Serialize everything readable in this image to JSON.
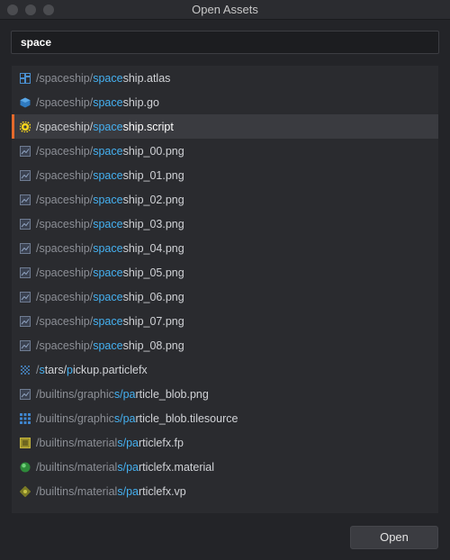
{
  "window": {
    "title": "Open Assets"
  },
  "search": {
    "value": "space"
  },
  "results": [
    {
      "dir": "/spaceship/",
      "match": "space",
      "rest": "ship.atlas",
      "icon": "atlas-icon",
      "selected": false
    },
    {
      "dir": "/spaceship/",
      "match": "space",
      "rest": "ship.go",
      "icon": "gameobject-icon",
      "selected": false
    },
    {
      "dir": "/spaceship/",
      "match": "space",
      "rest": "ship.script",
      "icon": "script-gear-icon",
      "selected": true
    },
    {
      "dir": "/spaceship/",
      "match": "space",
      "rest": "ship_00.png",
      "icon": "image-icon",
      "selected": false
    },
    {
      "dir": "/spaceship/",
      "match": "space",
      "rest": "ship_01.png",
      "icon": "image-icon",
      "selected": false
    },
    {
      "dir": "/spaceship/",
      "match": "space",
      "rest": "ship_02.png",
      "icon": "image-icon",
      "selected": false
    },
    {
      "dir": "/spaceship/",
      "match": "space",
      "rest": "ship_03.png",
      "icon": "image-icon",
      "selected": false
    },
    {
      "dir": "/spaceship/",
      "match": "space",
      "rest": "ship_04.png",
      "icon": "image-icon",
      "selected": false
    },
    {
      "dir": "/spaceship/",
      "match": "space",
      "rest": "ship_05.png",
      "icon": "image-icon",
      "selected": false
    },
    {
      "dir": "/spaceship/",
      "match": "space",
      "rest": "ship_06.png",
      "icon": "image-icon",
      "selected": false
    },
    {
      "dir": "/spaceship/",
      "match": "space",
      "rest": "ship_07.png",
      "icon": "image-icon",
      "selected": false
    },
    {
      "dir": "/spaceship/",
      "match": "space",
      "rest": "ship_08.png",
      "icon": "image-icon",
      "selected": false
    },
    {
      "dir": "/",
      "match": "s",
      "dir2": "tars/",
      "match2": "p",
      "rest": "ickup.particlefx",
      "icon": "particlefx-icon",
      "selected": false
    },
    {
      "dir": "/builtins/graphic",
      "match": "s/",
      "dir2": "",
      "match2": "pa",
      "rest": "rticle_blob.png",
      "icon": "image-icon",
      "selected": false
    },
    {
      "dir": "/builtins/graphic",
      "match": "s/",
      "dir2": "",
      "match2": "pa",
      "rest": "rticle_blob.tilesource",
      "icon": "tilesource-icon",
      "selected": false
    },
    {
      "dir": "/builtins/material",
      "match": "s/",
      "dir2": "",
      "match2": "pa",
      "rest": "rticlefx.fp",
      "icon": "fragment-program-icon",
      "selected": false
    },
    {
      "dir": "/builtins/material",
      "match": "s/",
      "dir2": "",
      "match2": "pa",
      "rest": "rticlefx.material",
      "icon": "material-icon",
      "selected": false
    },
    {
      "dir": "/builtins/material",
      "match": "s/",
      "dir2": "",
      "match2": "pa",
      "rest": "rticlefx.vp",
      "icon": "vertex-program-icon",
      "selected": false
    }
  ],
  "footer": {
    "open_label": "Open"
  },
  "colors": {
    "highlight": "#45b0f0",
    "selected_accent": "#e4692b",
    "background": "#232428"
  }
}
